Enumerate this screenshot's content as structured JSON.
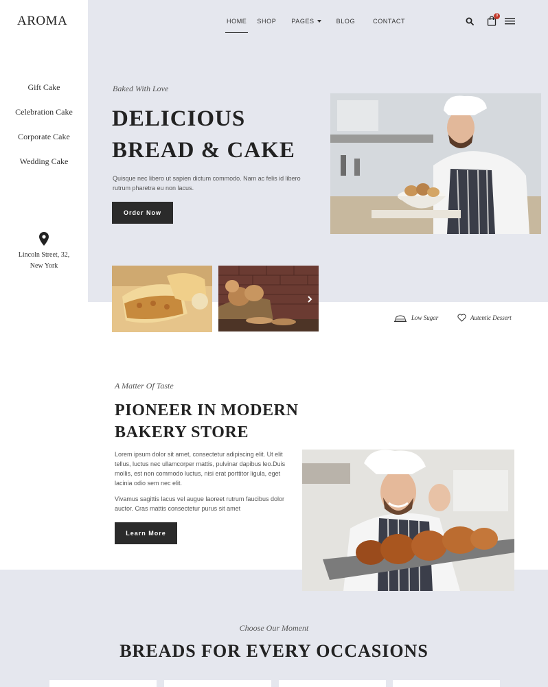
{
  "brand": {
    "logo": "AROMA"
  },
  "sidebar": {
    "items": [
      {
        "label": "Gift Cake"
      },
      {
        "label": "Celebration Cake"
      },
      {
        "label": "Corporate Cake"
      },
      {
        "label": "Wedding Cake"
      }
    ],
    "address_line1": "Lincoln Street, 32,",
    "address_line2": "New York"
  },
  "nav": {
    "items": [
      {
        "label": "HOME",
        "active": true
      },
      {
        "label": "SHOP"
      },
      {
        "label": "PAGES"
      },
      {
        "label": "BLOG"
      },
      {
        "label": "CONTACT"
      }
    ],
    "cart_count": "0",
    "icons": [
      "search-icon",
      "cart-icon",
      "menu-icon"
    ]
  },
  "hero": {
    "kicker": "Baked With Love",
    "title_line1": "DELICIOUS",
    "title_line2": "BREAD & CAKE",
    "description": "Quisque nec libero ut sapien dictum commodo. Nam ac felis id libero rutrum pharetra eu non lacus.",
    "button": "Order Now"
  },
  "features": [
    {
      "label": "Low Sugar",
      "icon": "cake-icon"
    },
    {
      "label": "Autentic Dessert",
      "icon": "heart-icon"
    }
  ],
  "about": {
    "kicker": "A Matter Of Taste",
    "title_line1": "PIONEER IN MODERN",
    "title_line2": "BAKERY STORE",
    "paragraph1": "Lorem ipsum dolor sit amet, consectetur adipiscing elit. Ut elit tellus, luctus nec ullamcorper mattis, pulvinar dapibus leo.Duis mollis, est non commodo luctus, nisi erat porttitor ligula, eget lacinia odio sem nec elit.",
    "paragraph2": "Vivamus sagittis lacus vel augue laoreet rutrum faucibus dolor auctor. Cras mattis consectetur purus sit amet",
    "button": "Learn More"
  },
  "occasions": {
    "kicker": "Choose Our Moment",
    "title": "BREADS FOR EVERY OCCASIONS"
  },
  "colors": {
    "hero_bg": "#e5e7ee",
    "button_bg": "#2b2b2b",
    "badge": "#c0392b"
  }
}
